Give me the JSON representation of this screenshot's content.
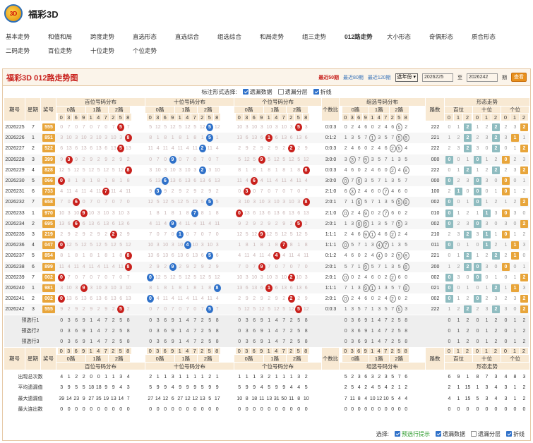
{
  "brand": "福彩3D",
  "nav_row1": [
    "基本走势",
    "和值和局",
    "跨度走势",
    "直选形态",
    "直选综合",
    "组选综合",
    "和局走势",
    "组三走势",
    "012路走势",
    "大小形态",
    "奇偶形态",
    "质合形态"
  ],
  "nav_row2": [
    "二码走势",
    "百位走势",
    "十位走势",
    "个位走势"
  ],
  "nav_active": "012路走势",
  "panel": {
    "title": "福彩3D 012路走势图",
    "periods": [
      "最近50期",
      "最近80期",
      "最近120期"
    ],
    "select": "选年份",
    "from": "2026225",
    "to_label": "至",
    "to": "2026242",
    "unit": "期",
    "query": "查看"
  },
  "opts": {
    "label": "标注形式选择:",
    "items": [
      {
        "label": "遗漏数据",
        "checked": true
      },
      {
        "label": "遗漏分层",
        "checked": false
      },
      {
        "label": "折线",
        "checked": true
      }
    ]
  },
  "headers": {
    "issue": "期号",
    "week": "星期",
    "prize": "奖号",
    "h": "百位号码分布",
    "t": "十位号码分布",
    "u": "个位号码分布",
    "cnt": "个数比",
    "grp": "组选号码分布",
    "path": "路数",
    "shape": "形态走势",
    "sh_h": "百位",
    "sh_t": "十位",
    "sh_u": "个位",
    "r0": "0路",
    "r1": "1路",
    "r2": "2路"
  },
  "digits012": [
    "0",
    "3",
    "6",
    "9",
    "1",
    "4",
    "7",
    "2",
    "5",
    "8"
  ],
  "digits0to9": [
    "0",
    "1",
    "2",
    "3",
    "4",
    "5",
    "6",
    "7",
    "8",
    "9"
  ],
  "rows": [
    [
      "2026225",
      "7",
      "555",
      "1:5",
      "0:0:3",
      "222",
      "2",
      "2",
      "2"
    ],
    [
      "2026226",
      "1",
      "851",
      "2:5",
      "0:1:2",
      "221",
      "2",
      "2",
      "1"
    ],
    [
      "2026227",
      "2",
      "522",
      "1:2",
      "0:0:3",
      "222",
      "2",
      "2",
      "2"
    ],
    [
      "2026228",
      "3",
      "399",
      "0:3",
      "3:0:0",
      "000",
      "0",
      "0",
      "0"
    ],
    [
      "2026229",
      "4",
      "828",
      "2:8",
      "0:0:3",
      "222",
      "2",
      "2",
      "2"
    ],
    [
      "2026230",
      "5",
      "066",
      "0:6",
      "3:0:0",
      "000",
      "0",
      "0",
      "0"
    ],
    [
      "2026231",
      "6",
      "733",
      "3:7",
      "2:1:0",
      "100",
      "1",
      "0",
      "0"
    ],
    [
      "2026232",
      "7",
      "658",
      "5:8",
      "2:0:1",
      "002",
      "0",
      "0",
      "2"
    ],
    [
      "2026233",
      "1",
      "970",
      "0:9",
      "2:1:0",
      "010",
      "0",
      "1",
      "0"
    ],
    [
      "2026234",
      "2",
      "695",
      "5:9",
      "2:0:1",
      "002",
      "0",
      "0",
      "2"
    ],
    [
      "2026235",
      "3",
      "219",
      "1:9",
      "1:1:1",
      "210",
      "2",
      "1",
      "0"
    ],
    [
      "2026236",
      "4",
      "047",
      "0:7",
      "1:1:1",
      "011",
      "0",
      "1",
      "1"
    ],
    [
      "2026237",
      "5",
      "854",
      "4:8",
      "0:1:2",
      "221",
      "2",
      "2",
      "1"
    ],
    [
      "2026238",
      "6",
      "899",
      "8:9",
      "2:0:1",
      "200",
      "2",
      "0",
      "0"
    ],
    [
      "2026239",
      "7",
      "002",
      "0:2",
      "2:0:1",
      "002",
      "0",
      "0",
      "2"
    ],
    [
      "2026240",
      "1",
      "981",
      "1:9",
      "1:1:1",
      "021",
      "0",
      "2",
      "1"
    ],
    [
      "2026241",
      "2",
      "002",
      "0:2",
      "2:0:1",
      "002",
      "0",
      "0",
      "2"
    ],
    [
      "2026242",
      "3",
      "555",
      "1:5",
      "0:0:3",
      "222",
      "2",
      "2",
      "2"
    ]
  ],
  "predict": [
    "预选行1",
    "预选行2",
    "预选行3"
  ],
  "stats": [
    {
      "label": "出现总次数",
      "vals": "4 1 2 2 0 0 1 1 3 4 2 1 1 3 1 1 1 1 2 1 1 1 1 3 2 1 1 1 3 2 5 2 3 6 3 2 3 5 7 6 9 1 8 7 3 4 8 3"
    },
    {
      "label": "平均遗漏值",
      "vals": "3 9 5 5 18 18 9 9 4 3 5 9 9 4 9 9 9 5 9 9 5 9 9 4 5 9 9 4 4 5 2 5 4 2 4 5 4 2 1 2 1 15 1 3 4 3 1 2"
    },
    {
      "label": "最大遗漏值",
      "vals": "39 14 23 9 27 35 19 13 14 7 27 14 12 6 27 12 12 13 5 17 10 8 18 11 13 31 50 11 8 10 7 11 8 4 10 12 10 5 4 4 1 15 5 3 4 3 1 2"
    },
    {
      "label": "最大连出数",
      "vals": "0 0 0 0 0 0 0 0 0 0 0 0 0 0 0 0 0 0 0 0 0 0 0 0 0 0 0 0 0 0 0 0 0 0 0 0 0 0 0 0 0 0 0 0 0 0 0 0"
    }
  ],
  "footer": {
    "label": "选择:",
    "items": [
      {
        "label": "预选行提示",
        "checked": true
      },
      {
        "label": "遗漏数据",
        "checked": true
      },
      {
        "label": "遗漏分层",
        "checked": false
      },
      {
        "label": "折线",
        "checked": true
      }
    ]
  },
  "colors": {
    "red": "#c8201c",
    "blue": "#2f71c9",
    "orange": "#e8a53a",
    "teal": "#8fbcc0"
  }
}
